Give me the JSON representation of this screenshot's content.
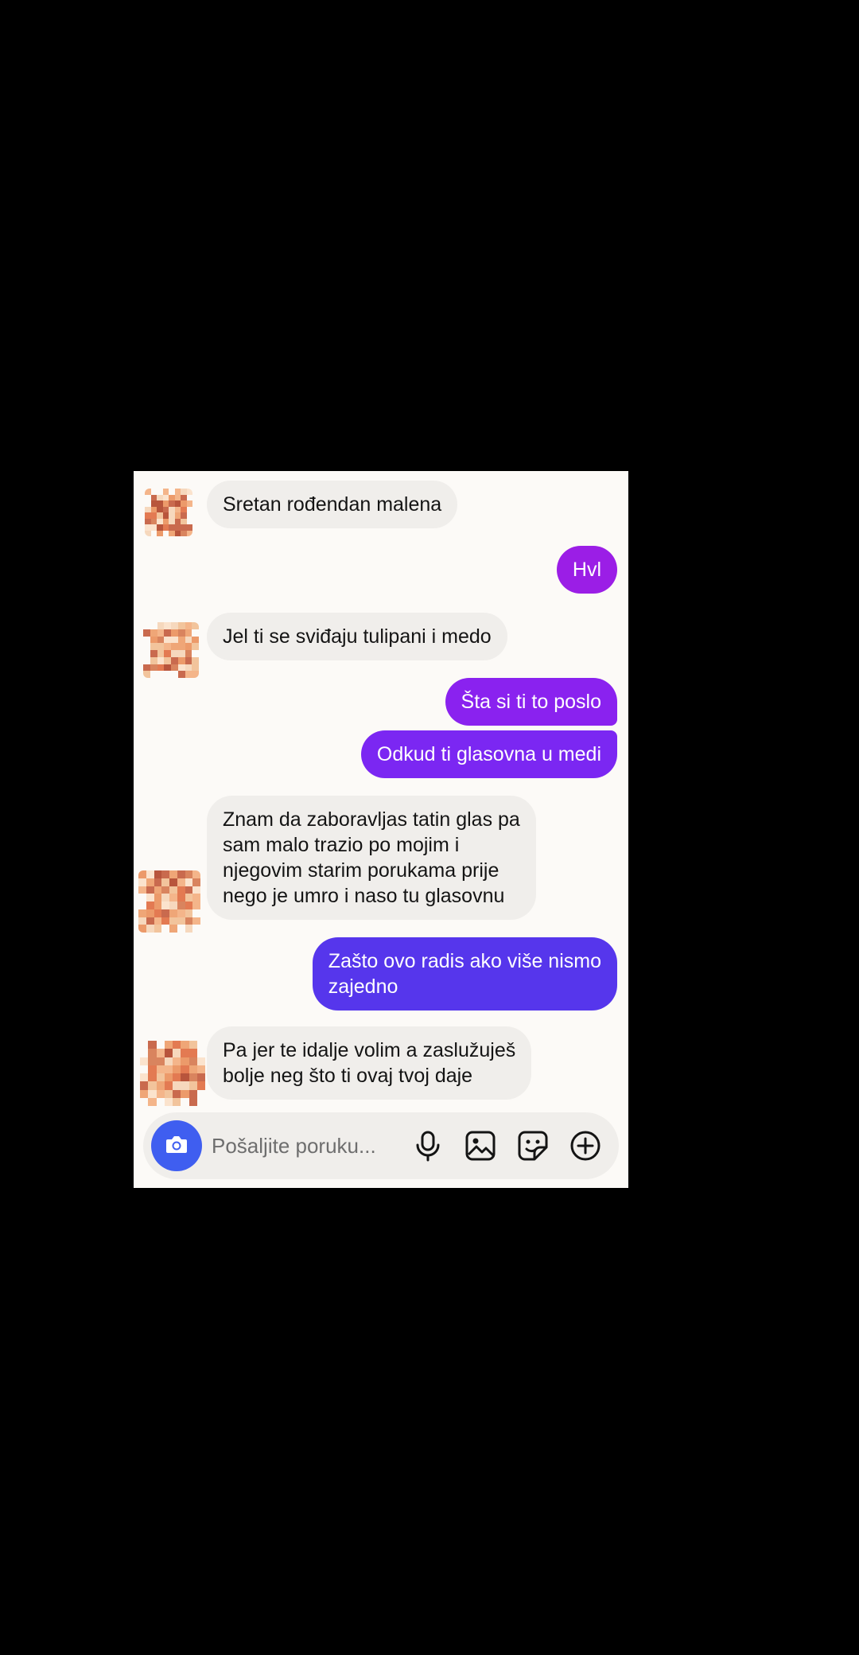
{
  "messages": [
    {
      "side": "in",
      "text": "Sretan rođendan malena"
    },
    {
      "side": "out",
      "text": "Hvl"
    },
    {
      "side": "in",
      "text": "Jel ti se sviđaju tulipani i medo"
    },
    {
      "side": "out",
      "text": "Šta si ti to poslo"
    },
    {
      "side": "out",
      "text": "Odkud ti glasovna u medi"
    },
    {
      "side": "in",
      "text": "Znam da zaboravljas tatin glas pa\nsam malo trazio po mojim i\nnjegovim starim porukama prije\nnego je umro  i naso tu glasovnu"
    },
    {
      "side": "out",
      "text": "Zašto ovo radis ako više nismo\nzajedno"
    },
    {
      "side": "in",
      "text": "Pa jer te idalje volim a zaslužuješ\nbolje neg što ti ovaj tvoj daje"
    }
  ],
  "composer": {
    "placeholder": "Pošaljite poruku...",
    "icons": [
      "camera-icon",
      "microphone-icon",
      "gallery-icon",
      "sticker-icon",
      "plus-icon"
    ]
  },
  "colors": {
    "background": "#fcfaf7",
    "incoming_bubble": "#f0eeeb",
    "outgoing_top": "#9b1ee6",
    "outgoing_mid": "#7a26f2",
    "outgoing_bottom": "#5436ec",
    "camera_button": "#3f5ef0"
  }
}
